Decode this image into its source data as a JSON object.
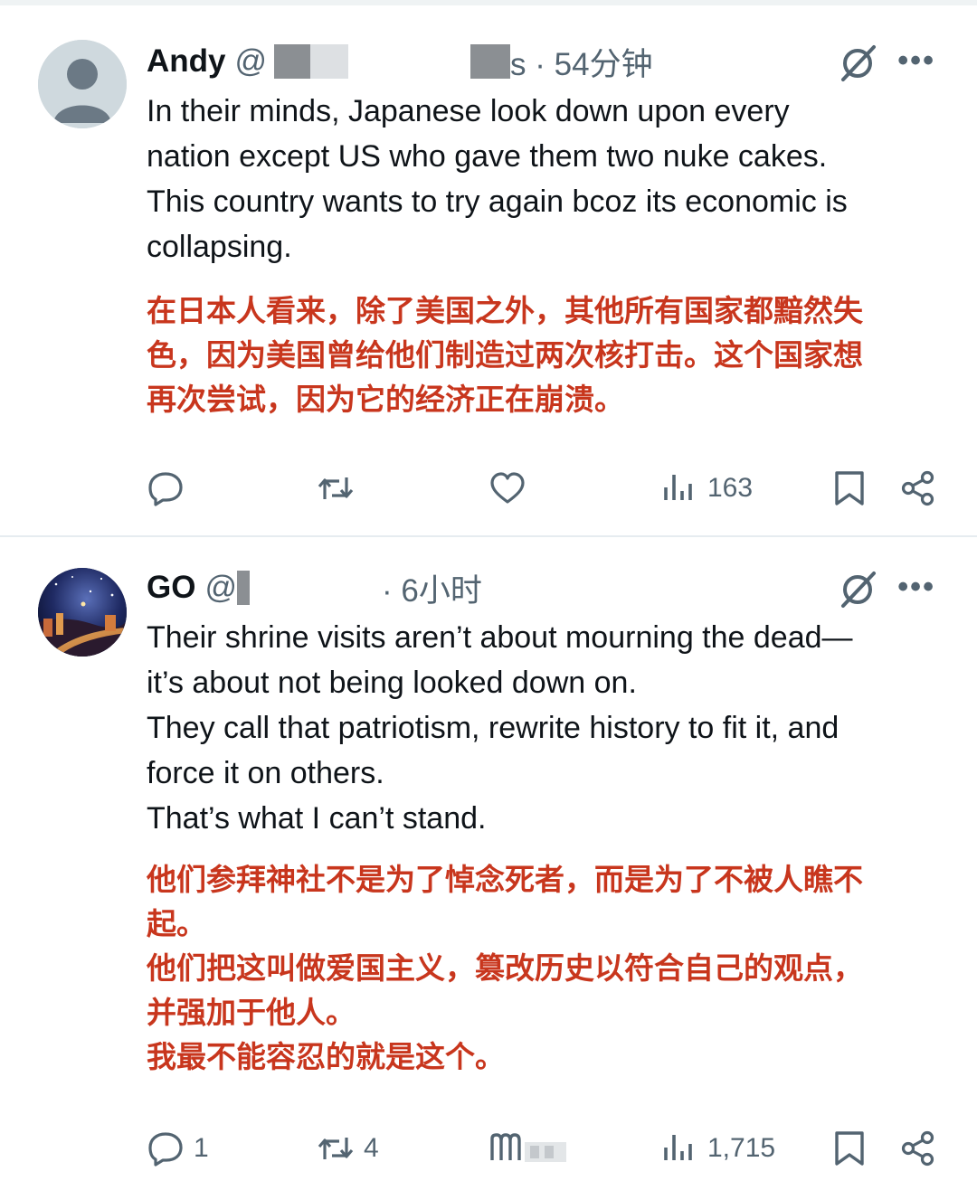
{
  "tweets": [
    {
      "name": "Andy",
      "handle": "@",
      "meta": "s · 54分钟",
      "body_en": [
        "In their minds, Japanese look down upon every",
        "nation except US who gave them two nuke cakes.",
        "This country wants to try again bcoz its economic is",
        "collapsing."
      ],
      "body_zh": [
        "在日本人看来，除了美国之外，其他所有国家都黯然失",
        "色，因为美国曾给他们制造过两次核打击。这个国家想",
        "再次尝试，因为它的经济正在崩溃。"
      ],
      "actions": {
        "reply_count": "",
        "repost_count": "",
        "like_count": "",
        "views": "163"
      }
    },
    {
      "name": "GO",
      "handle": "@",
      "meta": "· 6小时",
      "body_en": [
        "Their shrine visits aren’t about mourning the dead—",
        "it’s about not being looked down on.",
        "They call that patriotism, rewrite history to fit it, and",
        "force it on others.",
        "That’s what I can’t stand."
      ],
      "body_zh": [
        "他们参拜神社不是为了悼念死者，而是为了不被人瞧不",
        "起。",
        "他们把这叫做爱国主义，篡改历史以符合自己的观点，",
        "并强加于他人。",
        "我最不能容忍的就是这个。"
      ],
      "actions": {
        "reply_count": "1",
        "repost_count": "4",
        "like_count": "",
        "views": "1,715"
      }
    }
  ],
  "icons": {
    "reply": "reply-icon",
    "repost": "repost-icon",
    "like": "heart-icon",
    "views": "views-icon",
    "bookmark": "bookmark-icon",
    "share": "share-icon",
    "grok": "grok-icon",
    "more": "more-icon"
  },
  "more_glyph": "•••",
  "colors": {
    "translation_text": "#c8361d",
    "secondary_text": "#536471",
    "primary_text": "#0f1419"
  }
}
